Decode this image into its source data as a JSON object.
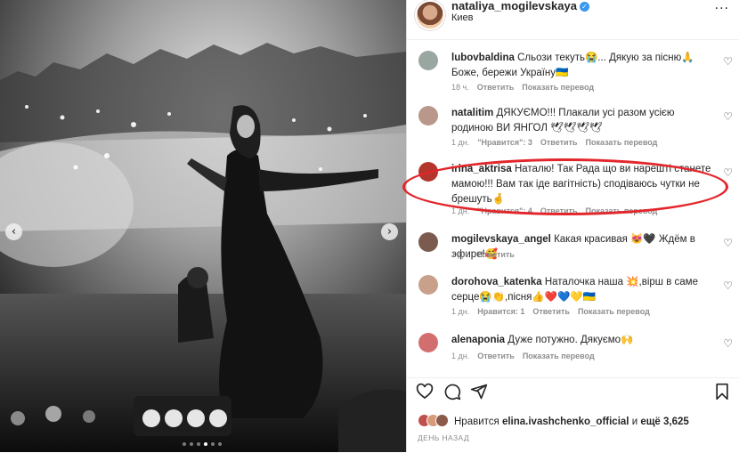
{
  "post": {
    "username": "nataliya_mogilevskaya",
    "location": "Киев"
  },
  "carousel": {
    "prev_icon": "‹",
    "next_icon": "›",
    "dots": 6,
    "active_dot": 4
  },
  "comments": [
    {
      "username": "lubovbaldina",
      "text": "Сльози текуть😭... Дякую за пісню🙏 Боже, бережи Україну🇺🇦",
      "meta": [
        "18 ч.",
        "Ответить",
        "Показать перевод"
      ],
      "avatar_color": "#9aa7a0"
    },
    {
      "username": "natalitim",
      "text": "ДЯКУЄМО!!! Плакали усі разом усією родиною ВИ ЯНГОЛ 🕊🕊🕊🕊",
      "meta": [
        "1 дн.",
        "\"Нравится\": 3",
        "Ответить",
        "Показать перевод"
      ],
      "avatar_color": "#b9978a"
    },
    {
      "username": "irina_aktrisa",
      "text": "Наталю! Так Рада що ви нарешті станете мамою!!! Вам так іде вагітність) сподіваюсь чутки не брешуть🤞",
      "meta": [
        "1 дн.",
        "\"Нравится\": 4",
        "Ответить",
        "Показать перевод"
      ],
      "avatar_color": "#b4352c"
    },
    {
      "username": "mogilevskaya_angel",
      "text": "Какая красивая 😻🖤 Ждём в эфире!🥰",
      "meta": [
        "1 дн.",
        "Ответить"
      ],
      "avatar_color": "#7a5b4d"
    },
    {
      "username": "dorohova_katenka",
      "text": "Наталочка наша 💥,вірш в саме серце😭👏,пісня👍❤️💙💛🇺🇦",
      "meta": [
        "1 дн.",
        "Нравится: 1",
        "Ответить",
        "Показать перевод"
      ],
      "avatar_color": "#c9a08a"
    },
    {
      "username": "alenaponia",
      "text": "Дуже потужно. Дякуємо🙌",
      "meta": [
        "1 дн.",
        "Ответить",
        "Показать перевод"
      ],
      "avatar_color": "#d36e6e"
    }
  ],
  "icons": {
    "heart": "♡",
    "more": "···"
  },
  "likes": {
    "prefix": "Нравится",
    "user": "elina.ivashchenko_official",
    "and": "и",
    "count_text": "ещё 3,625"
  },
  "time_label": "ДЕНЬ НАЗАД",
  "colors": {
    "highlight_ellipse": "#e3262b",
    "verified": "#3897f0",
    "meta_text": "#8e8e8e"
  }
}
